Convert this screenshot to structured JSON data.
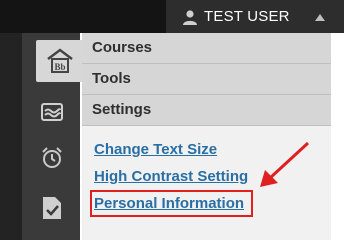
{
  "header": {
    "user_name": "TEST USER",
    "user_icon": "user-icon",
    "caret_icon": "caret-up-icon"
  },
  "rail": {
    "items": [
      {
        "icon": "blackboard-logo-icon"
      },
      {
        "icon": "wave-grades-icon"
      },
      {
        "icon": "alarm-clock-icon"
      },
      {
        "icon": "document-check-icon"
      }
    ]
  },
  "menu": {
    "items": [
      {
        "label": "Courses"
      },
      {
        "label": "Tools"
      },
      {
        "label": "Settings"
      }
    ]
  },
  "settings_submenu": {
    "items": [
      {
        "label": "Change Text Size"
      },
      {
        "label": "High Contrast Setting"
      },
      {
        "label": "Personal Information"
      }
    ]
  },
  "colors": {
    "link": "#2a6fa3",
    "highlight": "#e02020"
  }
}
